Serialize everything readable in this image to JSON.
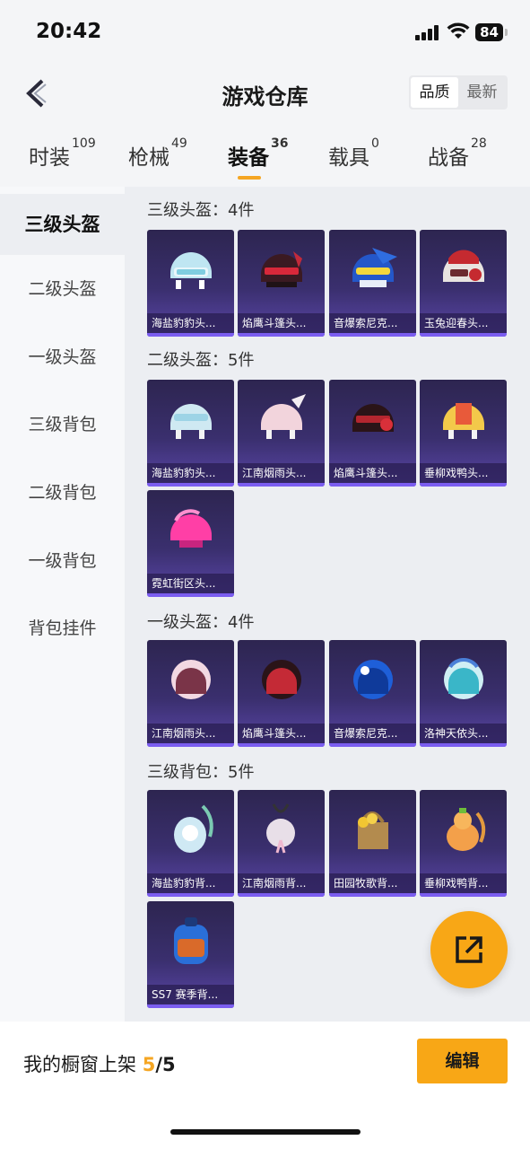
{
  "status_bar": {
    "time": "20:42",
    "battery": "84"
  },
  "header": {
    "title": "游戏仓库",
    "sort_options": [
      "品质",
      "最新"
    ],
    "sort_active": "品质"
  },
  "tabs": [
    {
      "label": "时装",
      "count": "109"
    },
    {
      "label": "枪械",
      "count": "49"
    },
    {
      "label": "装备",
      "count": "36"
    },
    {
      "label": "载具",
      "count": "0"
    },
    {
      "label": "战备",
      "count": "28"
    }
  ],
  "active_tab": "装备",
  "sidebar": {
    "items": [
      {
        "label": "三级头盔"
      },
      {
        "label": "二级头盔"
      },
      {
        "label": "一级头盔"
      },
      {
        "label": "三级背包"
      },
      {
        "label": "二级背包"
      },
      {
        "label": "一级背包"
      },
      {
        "label": "背包挂件"
      }
    ]
  },
  "sections": [
    {
      "title": "三级头盔：4件",
      "items": [
        "海盐豹豹头...",
        "焰鹰斗篷头...",
        "音爆索尼克...",
        "玉兔迎春头..."
      ]
    },
    {
      "title": "二级头盔：5件",
      "items": [
        "海盐豹豹头...",
        "江南烟雨头...",
        "焰鹰斗篷头...",
        "垂柳戏鸭头...",
        "霓虹街区头..."
      ]
    },
    {
      "title": "一级头盔：4件",
      "items": [
        "江南烟雨头...",
        "焰鹰斗篷头...",
        "音爆索尼克...",
        "洛神天依头..."
      ]
    },
    {
      "title": "三级背包：5件",
      "items": [
        "海盐豹豹背...",
        "江南烟雨背...",
        "田园牧歌背...",
        "垂柳戏鸭背...",
        "SS7 赛季背..."
      ]
    }
  ],
  "bottom_bar": {
    "label": "我的橱窗上架",
    "count": "5",
    "total": "/5",
    "edit_label": "编辑"
  },
  "icons": {
    "back": "chevron-left-icon",
    "share": "share-external-icon"
  },
  "colors": {
    "accent": "#f8a716",
    "card_bg": "#3a2f6e",
    "card_bottom": "#7b5df0"
  }
}
